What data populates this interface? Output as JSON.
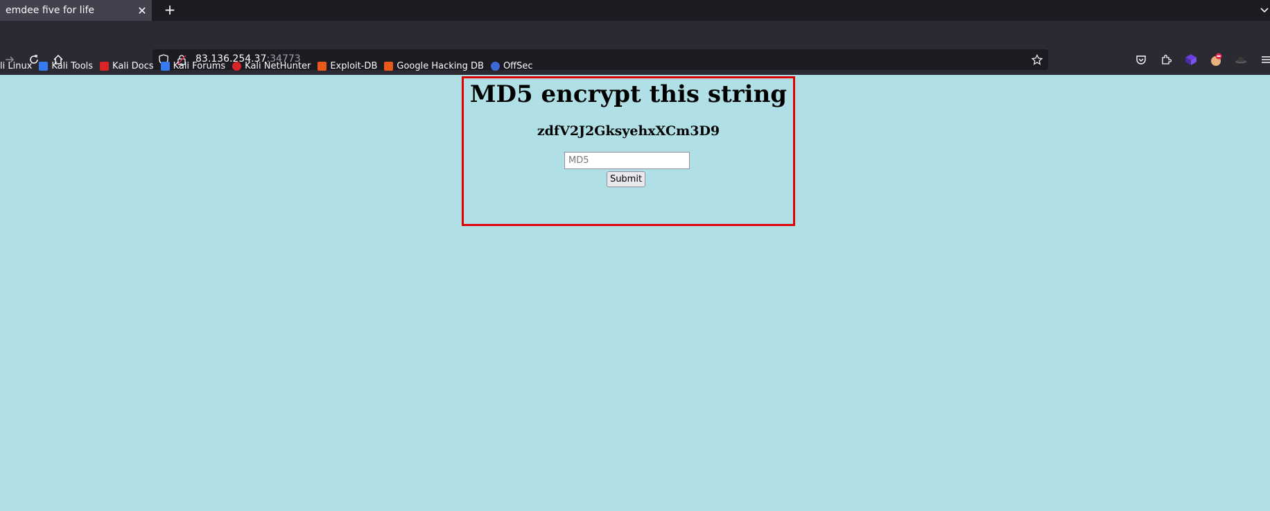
{
  "browser": {
    "tab": {
      "title": "emdee five for life",
      "close": "✕"
    },
    "new_tab": "+",
    "url": {
      "host": "83.136.254.37",
      "port": ":34773"
    },
    "bookmarks": [
      {
        "label": "li Linux",
        "color": "#367bf0"
      },
      {
        "label": "Kali Tools",
        "color": "#367bf0"
      },
      {
        "label": "Kali Docs",
        "color": "#d92525"
      },
      {
        "label": "Kali Forums",
        "color": "#367bf0"
      },
      {
        "label": "Kali NetHunter",
        "color": "#d92525"
      },
      {
        "label": "Exploit-DB",
        "color": "#e8591a"
      },
      {
        "label": "Google Hacking DB",
        "color": "#e8591a"
      },
      {
        "label": "OffSec",
        "color": "#3b6bd8"
      }
    ],
    "colors": {
      "tabbar": "#1c1b22",
      "toolbar": "#2b2a33",
      "urlbar": "#1c1b22"
    }
  },
  "page": {
    "heading": "MD5 encrypt this string",
    "challenge": "zdfV2J2GksyehxXCm3D9",
    "input_placeholder": "MD5",
    "submit_label": "Submit",
    "colors": {
      "background": "#b0e0e6",
      "border": "#e00000"
    }
  }
}
